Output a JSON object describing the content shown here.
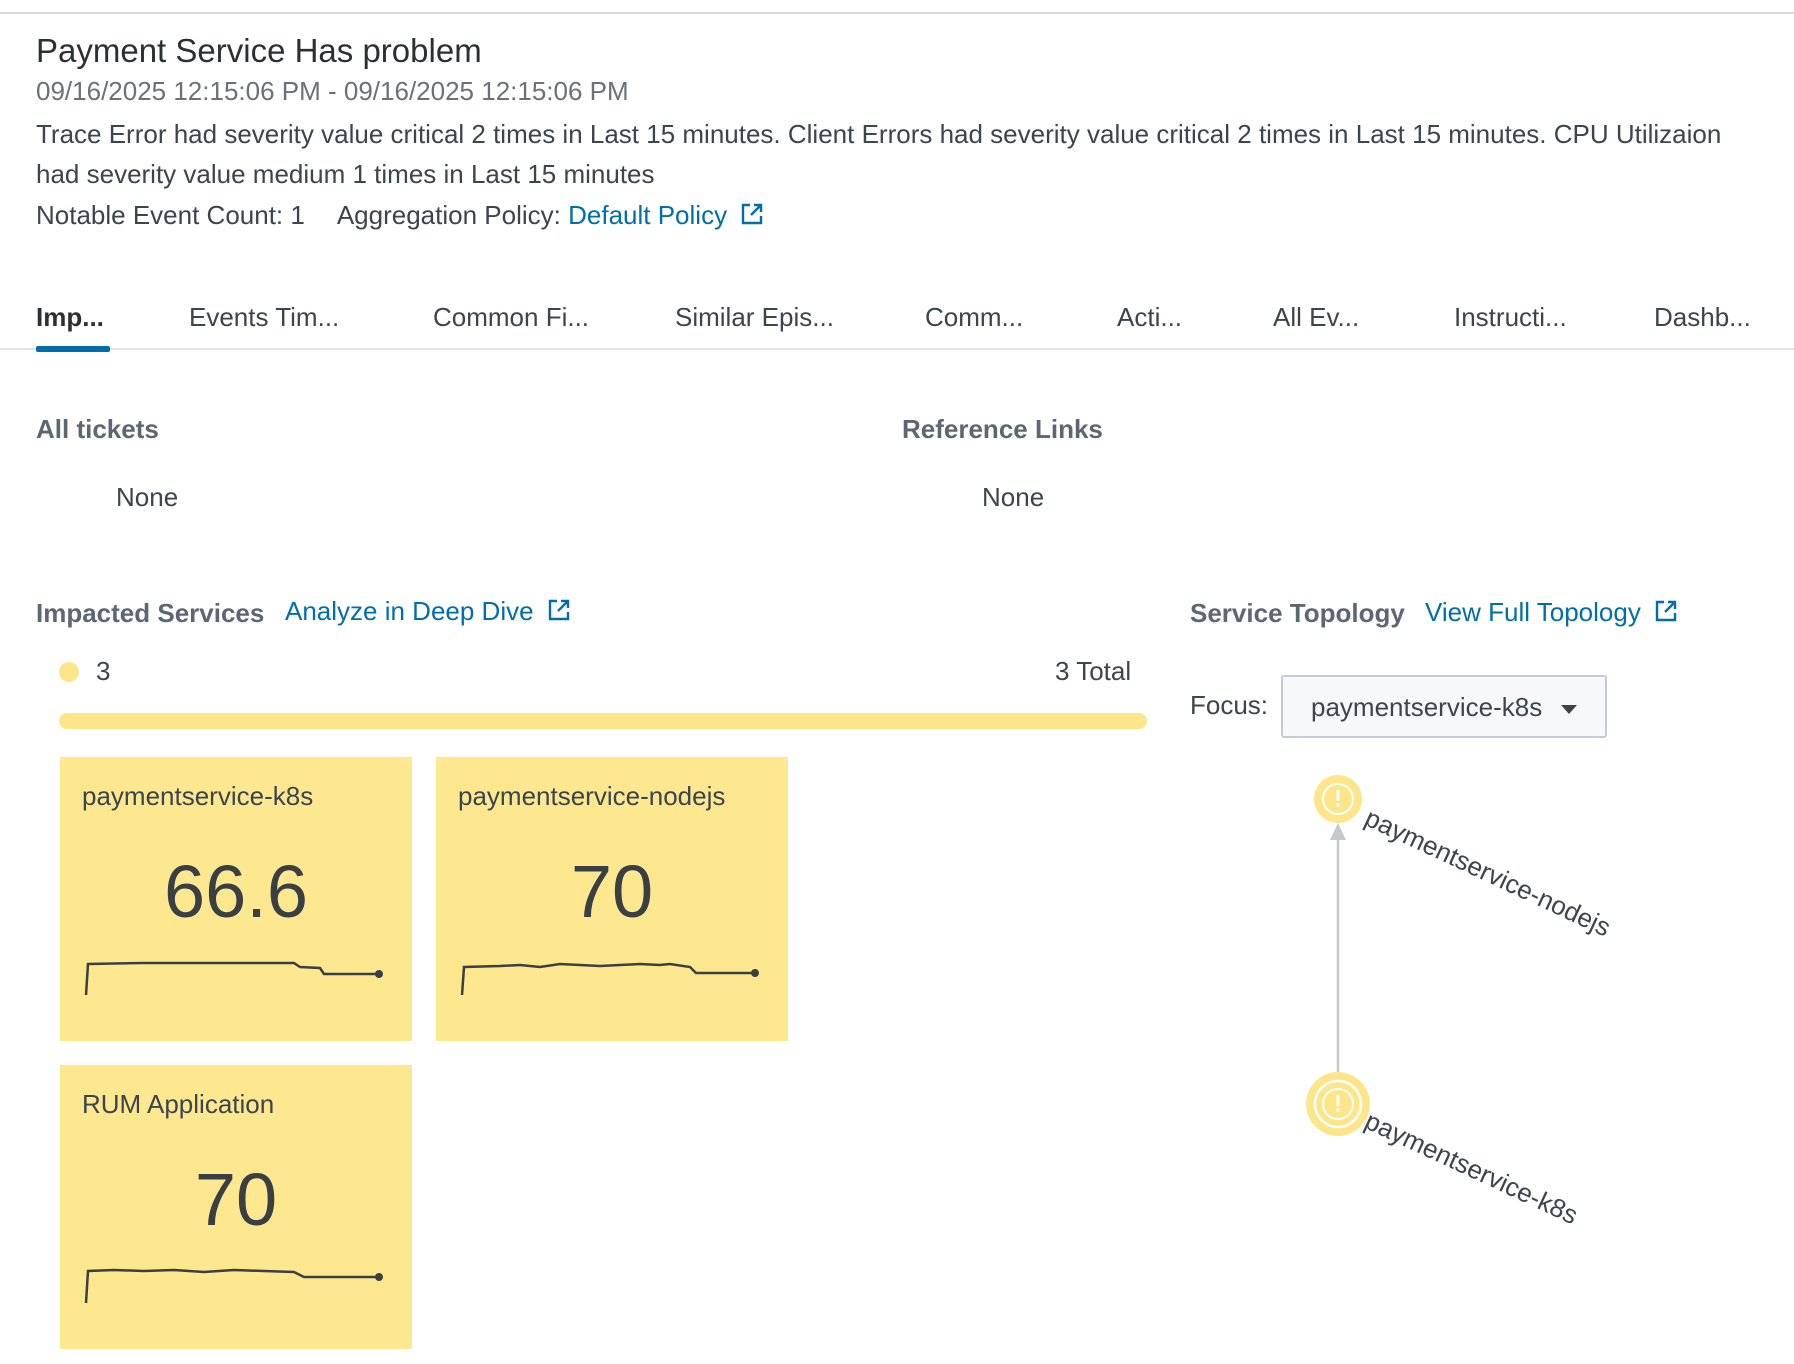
{
  "episode": {
    "title": "Payment Service Has problem",
    "date_range": "09/16/2025 12:15:06 PM - 09/16/2025 12:15:06 PM",
    "description": "Trace Error had severity value critical 2 times in Last 15 minutes. Client Errors had severity value critical 2 times in Last 15 minutes. CPU Utilizaion had severity value medium 1 times in Last 15 minutes",
    "notable_event_count": "Notable Event Count: 1",
    "aggregation_policy_label": "Aggregation Policy:",
    "aggregation_policy_link": "Default Policy"
  },
  "tabs": [
    {
      "label": "Imp...",
      "active": true
    },
    {
      "label": "Events Tim..."
    },
    {
      "label": "Common Fi..."
    },
    {
      "label": "Similar Epis..."
    },
    {
      "label": "Comm..."
    },
    {
      "label": "Acti..."
    },
    {
      "label": "All Ev..."
    },
    {
      "label": "Instructi..."
    },
    {
      "label": "Dashb..."
    }
  ],
  "tickets": {
    "heading": "All tickets",
    "value": "None"
  },
  "reference_links": {
    "heading": "Reference Links",
    "value": "None"
  },
  "impacted_services": {
    "heading": "Impacted Services",
    "link": "Analyze in Deep Dive",
    "legend_count": "3",
    "legend_total": "3 Total",
    "severity_color": "#fde88f",
    "tiles": [
      {
        "name": "paymentservice-k8s",
        "value": "66.6"
      },
      {
        "name": "paymentservice-nodejs",
        "value": "70"
      },
      {
        "name": "RUM Application",
        "value": "70"
      }
    ]
  },
  "topology": {
    "heading": "Service Topology",
    "link": "View Full Topology",
    "focus_label": "Focus:",
    "focus_value": "paymentservice-k8s",
    "nodes": [
      {
        "name": "paymentservice-nodejs",
        "icon": "alert-icon"
      },
      {
        "name": "paymentservice-k8s",
        "icon": "alert-icon",
        "focused": true
      }
    ]
  }
}
